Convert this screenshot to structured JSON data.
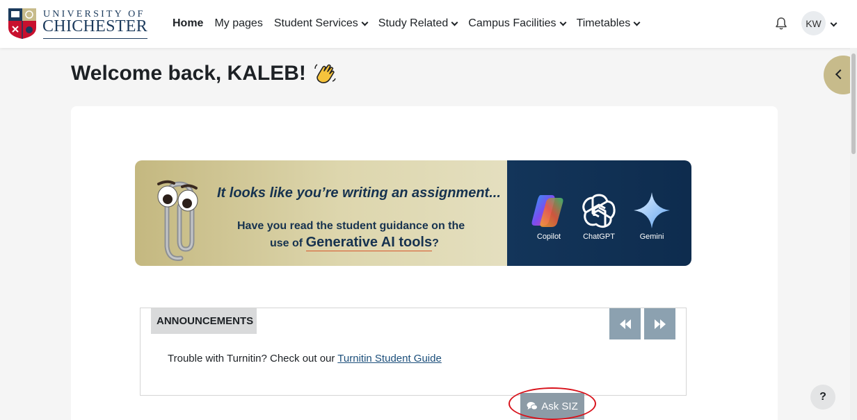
{
  "header": {
    "logo": {
      "line1": "UNIVERSITY OF",
      "line2": "CHICHESTER"
    },
    "nav": [
      {
        "label": "Home",
        "active": true,
        "dropdown": false
      },
      {
        "label": "My pages",
        "active": false,
        "dropdown": false
      },
      {
        "label": "Student Services",
        "active": false,
        "dropdown": true
      },
      {
        "label": "Study Related",
        "active": false,
        "dropdown": true
      },
      {
        "label": "Campus Facilities",
        "active": false,
        "dropdown": true
      },
      {
        "label": "Timetables",
        "active": false,
        "dropdown": true
      }
    ],
    "notifications_icon": "bell-icon",
    "user_initials": "KW"
  },
  "welcome": {
    "text": "Welcome back, KALEB!",
    "emoji_icon": "waving-hand-icon"
  },
  "banner": {
    "headline": "It looks like you’re writing an assignment...",
    "line2": "Have you read the student guidance on the",
    "line3_prefix": "use of ",
    "line3_highlight": "Generative AI tools",
    "line3_suffix": "?",
    "tools": [
      {
        "name": "Copilot",
        "icon": "copilot-icon"
      },
      {
        "name": "ChatGPT",
        "icon": "chatgpt-icon"
      },
      {
        "name": "Gemini",
        "icon": "gemini-icon"
      }
    ]
  },
  "announcements": {
    "title": "ANNOUNCEMENTS",
    "text": "Trouble with Turnitin? Check out our ",
    "link": "Turnitin Student Guide"
  },
  "ask_button": {
    "label": "Ask SIZ",
    "icon": "chat-bubbles-icon"
  },
  "help_button": {
    "label": "?"
  },
  "colors": {
    "accent_gold": "#c7bb8b",
    "navy": "#1b3a5c",
    "announcement_button": "#8ca1b0",
    "highlight_ring": "#d8131c"
  }
}
